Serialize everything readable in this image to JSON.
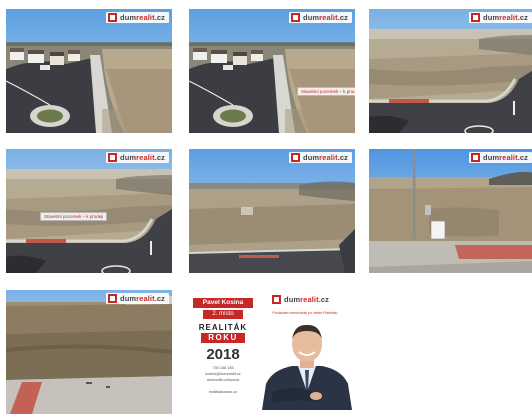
{
  "brand": {
    "logo_prefix": "dum",
    "logo_accent": "realit",
    "logo_suffix": ".cz",
    "red": "#c62828"
  },
  "gallery": {
    "photos": [
      {
        "label": ""
      },
      {
        "label": "Stavební pozemek – k prodeji"
      },
      {
        "label": ""
      },
      {
        "label": "Stavební pozemek – k prodeji"
      },
      {
        "label": ""
      },
      {
        "label": ""
      },
      {
        "label": ""
      }
    ]
  },
  "agent_card": {
    "name": "Pavel Kosina",
    "place": "2. místo",
    "award_line1": "REALITÁK",
    "award_line2": "ROKU",
    "year": "2018",
    "slogan": "Prodávám nemovitosti po celém Plzeňsku",
    "phone": "730 168 185",
    "email": "kosina@dumrealit.cz",
    "web": "dumrealit.cz/kosina",
    "web2": "realitkakosina.cz"
  }
}
